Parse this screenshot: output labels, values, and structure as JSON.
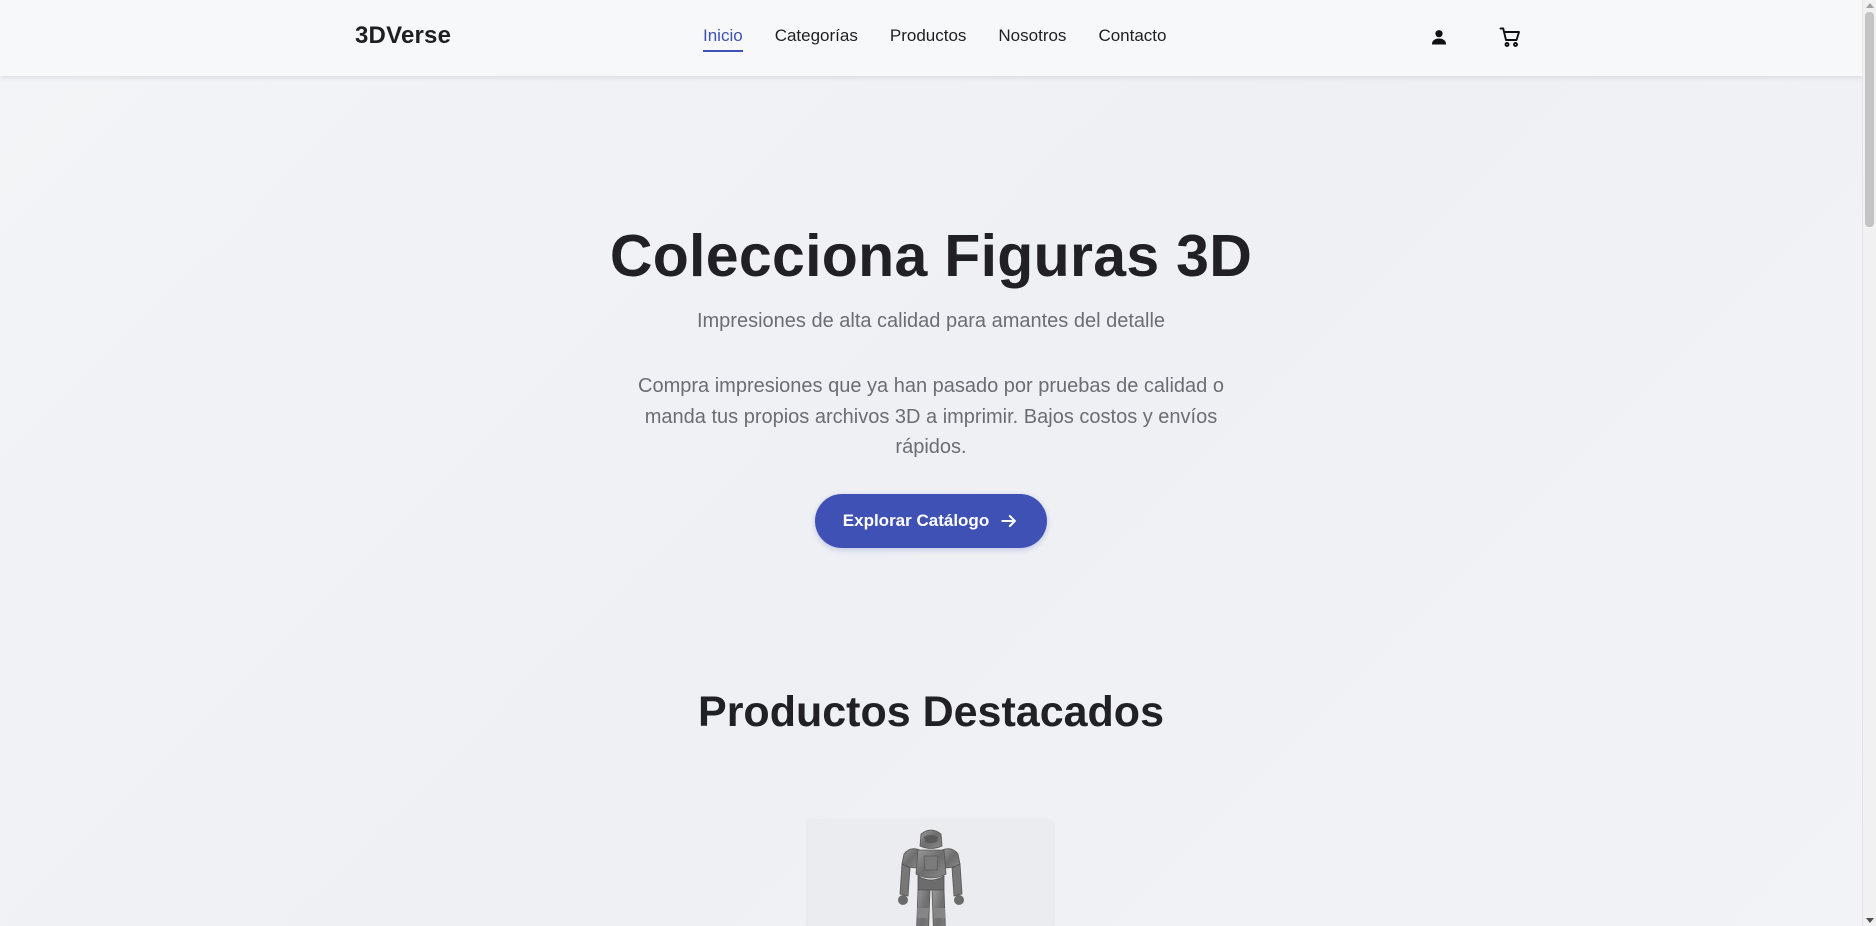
{
  "header": {
    "logo": "3DVerse",
    "nav": [
      {
        "label": "Inicio",
        "active": true
      },
      {
        "label": "Categorías",
        "active": false
      },
      {
        "label": "Productos",
        "active": false
      },
      {
        "label": "Nosotros",
        "active": false
      },
      {
        "label": "Contacto",
        "active": false
      }
    ],
    "icons": [
      "person-icon",
      "shopping-cart-icon"
    ]
  },
  "hero": {
    "title": "Colecciona Figuras 3D",
    "subtitle": "Impresiones de alta calidad para amantes del detalle",
    "description": "Compra impresiones que ya han pasado por pruebas de calidad o manda tus propios archivos 3D a imprimir. Bajos costos y envíos rápidos.",
    "cta_label": "Explorar Catálogo",
    "cta_icon": "arrow-right-icon"
  },
  "featured": {
    "title": "Productos Destacados"
  },
  "colors": {
    "accent": "#3f51b5",
    "text": "#212125",
    "muted": "#6b6d73",
    "background": "#f1f2f6"
  }
}
